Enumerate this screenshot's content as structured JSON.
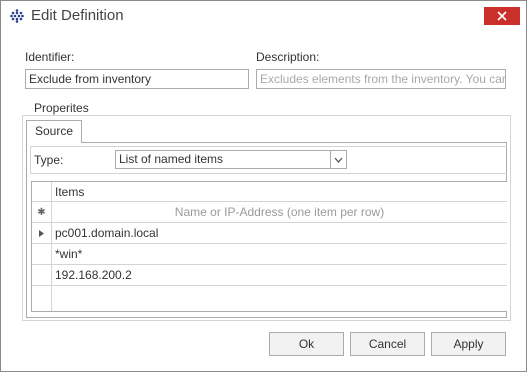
{
  "window": {
    "title": "Edit Definition",
    "close_label": "✕"
  },
  "identifier": {
    "label": "Identifier:",
    "value": "Exclude from inventory"
  },
  "description": {
    "label": "Description:",
    "placeholder": "Excludes elements from the inventory. You can use"
  },
  "properties": {
    "group_label": "Properites",
    "tab_label": "Source",
    "type_label": "Type:",
    "type_value": "List of named items"
  },
  "grid": {
    "header": "Items",
    "new_row_placeholder": "Name or IP-Address (one item per row)",
    "new_row_marker": "✱",
    "rows": [
      "pc001.domain.local",
      "*win*",
      "192.168.200.2"
    ]
  },
  "buttons": {
    "ok": "Ok",
    "cancel": "Cancel",
    "apply": "Apply"
  },
  "icons": {
    "app": "app-grid-icon",
    "close": "close-icon",
    "dropdown": "chevron-down-icon",
    "current_row": "row-pointer-icon"
  },
  "colors": {
    "close_button": "#c9302c",
    "app_icon": "#2a3f8f"
  }
}
